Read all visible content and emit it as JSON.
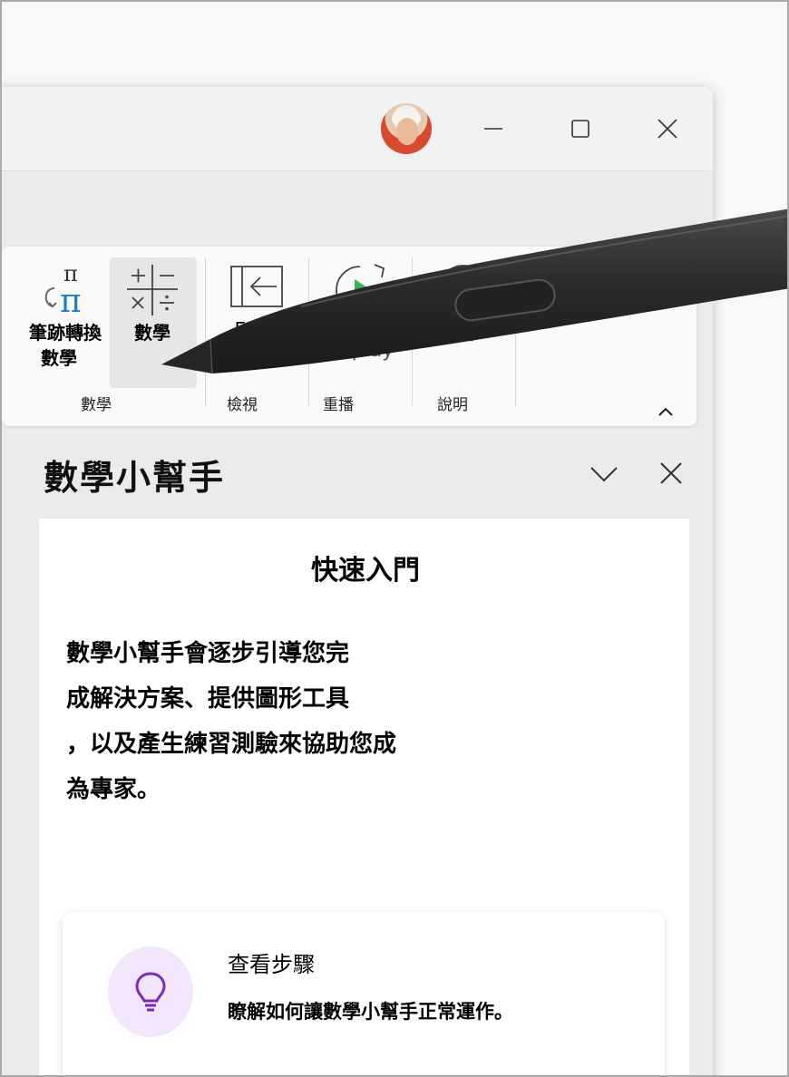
{
  "window": {
    "controls": {
      "minimize": "minimize",
      "maximize": "maximize",
      "close": "close"
    }
  },
  "ribbon": {
    "buttons": {
      "ink_to_math": {
        "line1": "筆跡轉換",
        "line2": "數學"
      },
      "math": {
        "label": "數學"
      },
      "view_partial": "E",
      "replay": {
        "label": "Replay"
      },
      "help_partial": "p"
    },
    "groups": {
      "math": "數學",
      "view": "檢視",
      "replay": "重播",
      "help": "說明"
    }
  },
  "pane": {
    "title": "數學小幫手",
    "card": {
      "heading": "快速入門",
      "description_lines": [
        "數學小幫手會逐步引導您完",
        "成解決方案、提供圖形工具",
        "，以及產生練習測驗來協助您成",
        "為專家。"
      ],
      "tip": {
        "title": "查看步驟",
        "text": "瞭解如何讓數學小幫手正常運作。"
      }
    }
  },
  "colors": {
    "accent_blue": "#1a7fd1",
    "replay_green": "#39b54a",
    "tip_icon_bg": "#f1e6fb",
    "tip_icon_fg": "#7a2bbd",
    "pen_body": "#2b2b2b"
  }
}
